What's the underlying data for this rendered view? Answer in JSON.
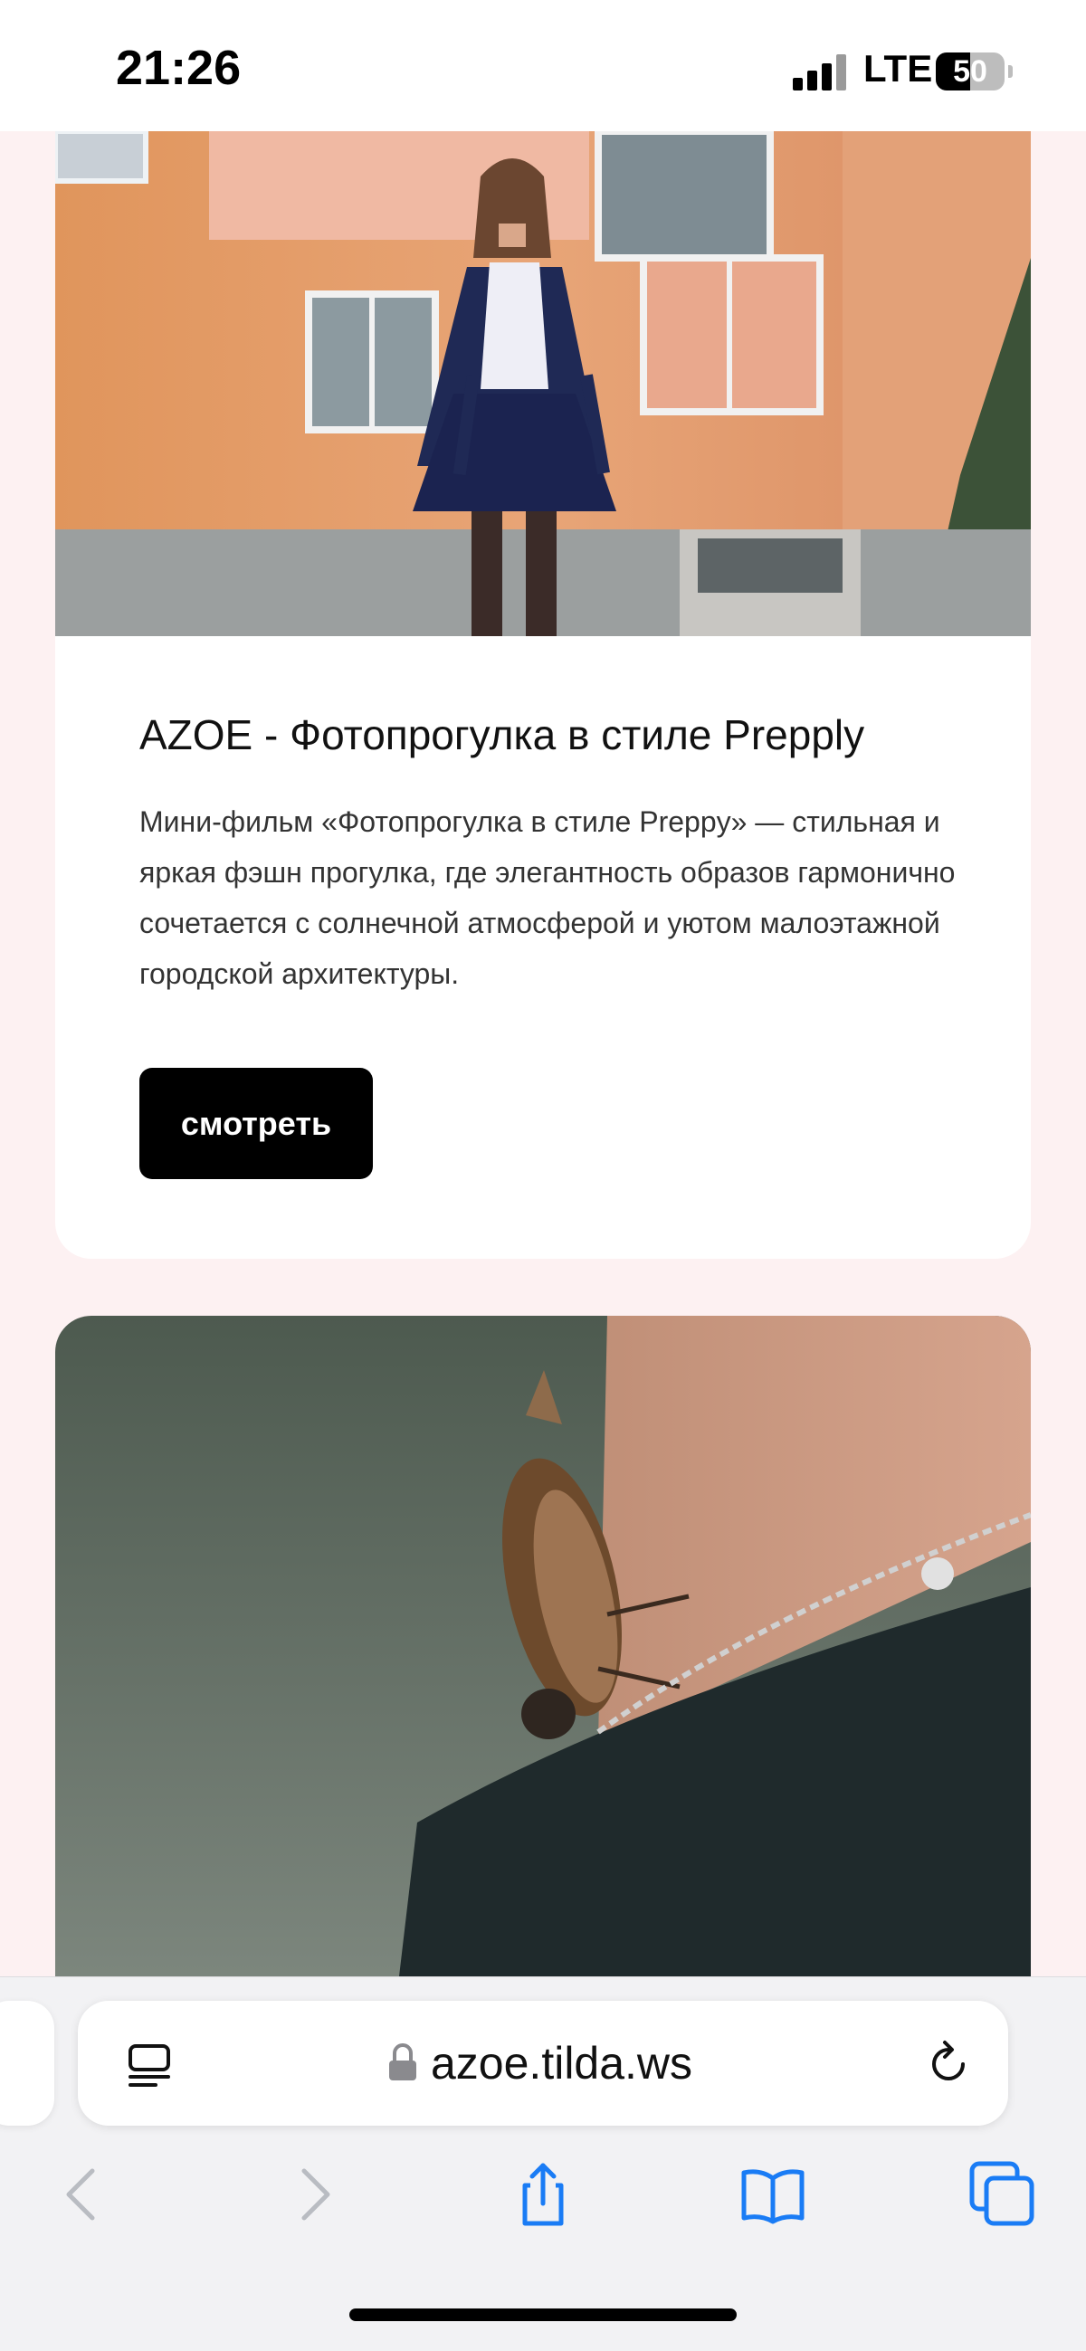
{
  "status_bar": {
    "time": "21:26",
    "network": "LTE",
    "battery": "50"
  },
  "card1": {
    "title": "AZOE - Фотопрогулка в стиле Prepply",
    "description": "Мини-фильм «Фотопрогулка в стиле Preppy» — стильная и яркая фэшн прогулка, где элегантность образов гармонично сочетается с солнечной атмосферой и уютом малоэтажной городской архитектуры.",
    "button_label": "смотреть"
  },
  "browser": {
    "address": "azoe.tilda.ws"
  },
  "colors": {
    "page_background": "#fdf1f2",
    "card_background": "#ffffff",
    "button_background": "#000000",
    "toolbar_accent": "#1a7cf5"
  }
}
